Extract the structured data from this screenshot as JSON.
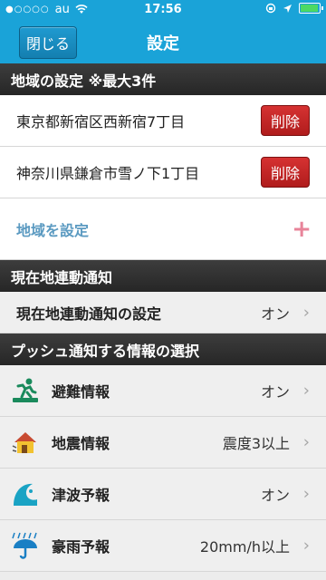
{
  "status_bar": {
    "carrier": "au",
    "time": "17:56",
    "signal_dots": "●○○○○"
  },
  "nav": {
    "close_label": "閉じる",
    "title": "設定"
  },
  "region": {
    "header": "地域の設定 ※最大3件",
    "items": [
      {
        "address": "東京都新宿区西新宿7丁目",
        "delete_label": "削除"
      },
      {
        "address": "神奈川県鎌倉市雪ノ下1丁目",
        "delete_label": "削除"
      }
    ],
    "add_label": "地域を設定",
    "add_symbol": "+"
  },
  "location_notify": {
    "header": "現在地連動通知",
    "setting_label": "現在地連動通知の設定",
    "setting_value": "オン"
  },
  "push": {
    "header": "プッシュ通知する情報の選択",
    "items": [
      {
        "label": "避難情報",
        "value": "オン",
        "icon": "evacuation-icon"
      },
      {
        "label": "地震情報",
        "value": "震度3以上",
        "icon": "earthquake-icon"
      },
      {
        "label": "津波予報",
        "value": "オン",
        "icon": "tsunami-icon"
      },
      {
        "label": "豪雨予報",
        "value": "20mm/h以上",
        "icon": "heavy-rain-icon"
      }
    ]
  },
  "chevron": "›",
  "colors": {
    "accent": "#1aa3d8",
    "delete": "#c62626",
    "add_text": "#5b9ac1",
    "plus": "#e8849a"
  }
}
